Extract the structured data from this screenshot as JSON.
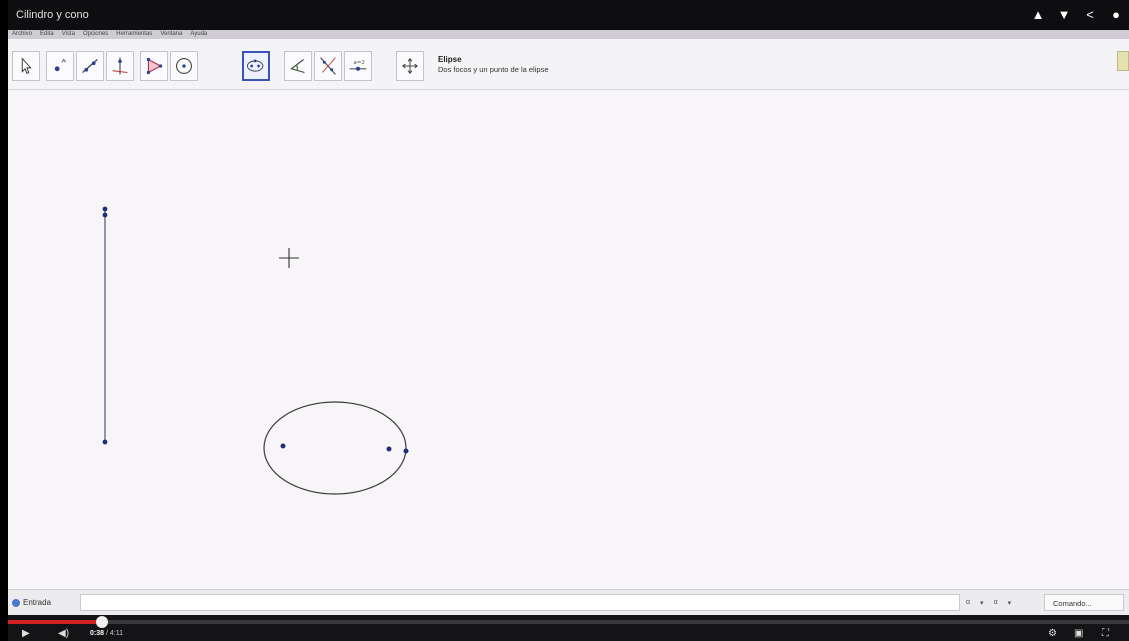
{
  "video": {
    "title": "Cilindro y cono",
    "current_time": "0:38",
    "duration": "4:11",
    "progress_fraction": 0.084,
    "actions": [
      "thumbs-up-icon",
      "thumbs-down-icon",
      "share-icon",
      "info-icon"
    ]
  },
  "menu": {
    "items": [
      "Archivo",
      "Edita",
      "Vista",
      "Opciones",
      "Herramientas",
      "Ventana",
      "Ayuda"
    ]
  },
  "toolbar": {
    "tools": [
      {
        "name": "move-tool-icon"
      },
      {
        "name": "point-tool-icon"
      },
      {
        "name": "line-tool-icon"
      },
      {
        "name": "perpendicular-tool-icon"
      },
      {
        "name": "polygon-tool-icon"
      },
      {
        "name": "circle-tool-icon"
      },
      {
        "name": "ellipse-tool-icon",
        "active": true
      },
      {
        "name": "angle-tool-icon"
      },
      {
        "name": "reflect-tool-icon"
      },
      {
        "name": "slider-tool-icon"
      },
      {
        "name": "move-view-tool-icon"
      }
    ],
    "help_name": "Elipse",
    "help_desc": "Dos focos y un punto de la elipse"
  },
  "input_bar": {
    "label": "Entrada",
    "controls": [
      "α",
      "▾",
      "α",
      "▾"
    ],
    "command_placeholder": "Comando..."
  }
}
